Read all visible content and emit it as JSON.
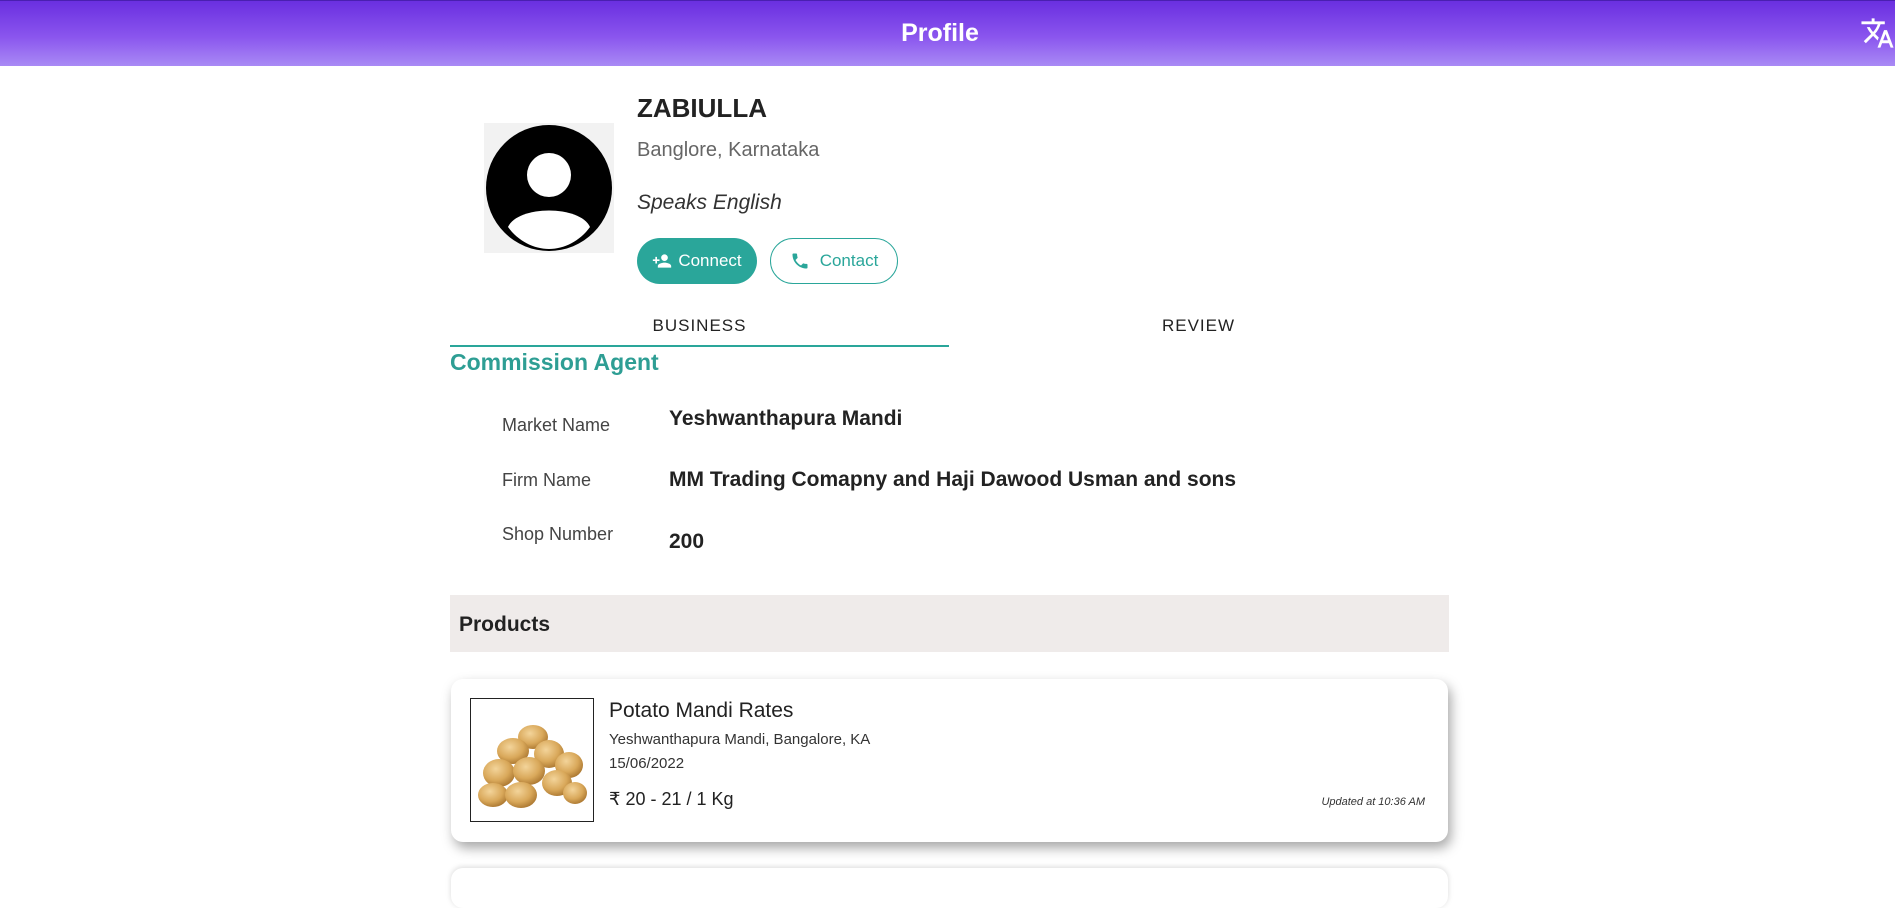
{
  "appbar": {
    "title": "Profile",
    "translate_icon": "translate-icon"
  },
  "profile": {
    "name": "ZABIULLA",
    "location": "Banglore, Karnataka",
    "speaks": "Speaks English",
    "avatar_icon": "account-circle-icon",
    "connect_label": "Connect",
    "contact_label": "Contact"
  },
  "tabs": [
    {
      "label": "BUSINESS",
      "active": true
    },
    {
      "label": "REVIEW",
      "active": false
    }
  ],
  "business": {
    "role": "Commission Agent",
    "fields": [
      {
        "label": "Market Name",
        "value": "Yeshwanthapura Mandi"
      },
      {
        "label": "Firm Name",
        "value": "MM Trading Comapny and Haji Dawood Usman and sons"
      },
      {
        "label": "Shop Number",
        "value": "200"
      }
    ]
  },
  "products": {
    "heading": "Products",
    "items": [
      {
        "title": "Potato Mandi Rates",
        "market": "Yeshwanthapura Mandi, Bangalore, KA",
        "date": "15/06/2022",
        "price": "₹ 20 - 21 / 1 Kg",
        "updated": "Updated at 10:36 AM"
      }
    ]
  },
  "colors": {
    "accent": "#2aa69a",
    "appbar_top": "#6a2fe0",
    "appbar_bottom": "#a98af5"
  }
}
